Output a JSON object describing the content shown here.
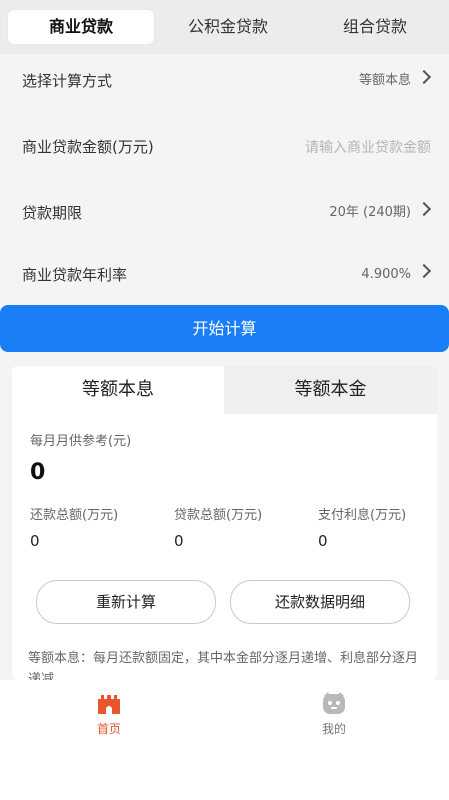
{
  "tabs": {
    "commercial": "商业贷款",
    "provident": "公积金贷款",
    "combined": "组合贷款"
  },
  "form": {
    "method_label": "选择计算方式",
    "method_value": "等额本息",
    "amount_label": "商业贷款金额(万元)",
    "amount_value": "",
    "amount_placeholder": "请输入商业贷款金额",
    "term_label": "贷款期限",
    "term_value": "20年 (240期)",
    "rate_label": "商业贷款年利率",
    "rate_value": "4.900%"
  },
  "start_button": "开始计算",
  "result": {
    "tab_equal_installment": "等额本息",
    "tab_equal_principal": "等额本金",
    "monthly_label": "每月月供参考(元)",
    "monthly_value": "0",
    "total_repay_label": "还款总额(万元)",
    "total_repay_value": "0",
    "total_loan_label": "贷款总额(万元)",
    "total_loan_value": "0",
    "interest_label": "支付利息(万元)",
    "interest_value": "0",
    "recalc_button": "重新计算",
    "detail_button": "还款数据明细",
    "description": "等额本息：每月还款额固定，其中本金部分逐月递增、利息部分逐月递减"
  },
  "nav": {
    "home": "首页",
    "mine": "我的"
  },
  "colors": {
    "accent": "#1a7ef6",
    "nav_active": "#e8552f"
  }
}
